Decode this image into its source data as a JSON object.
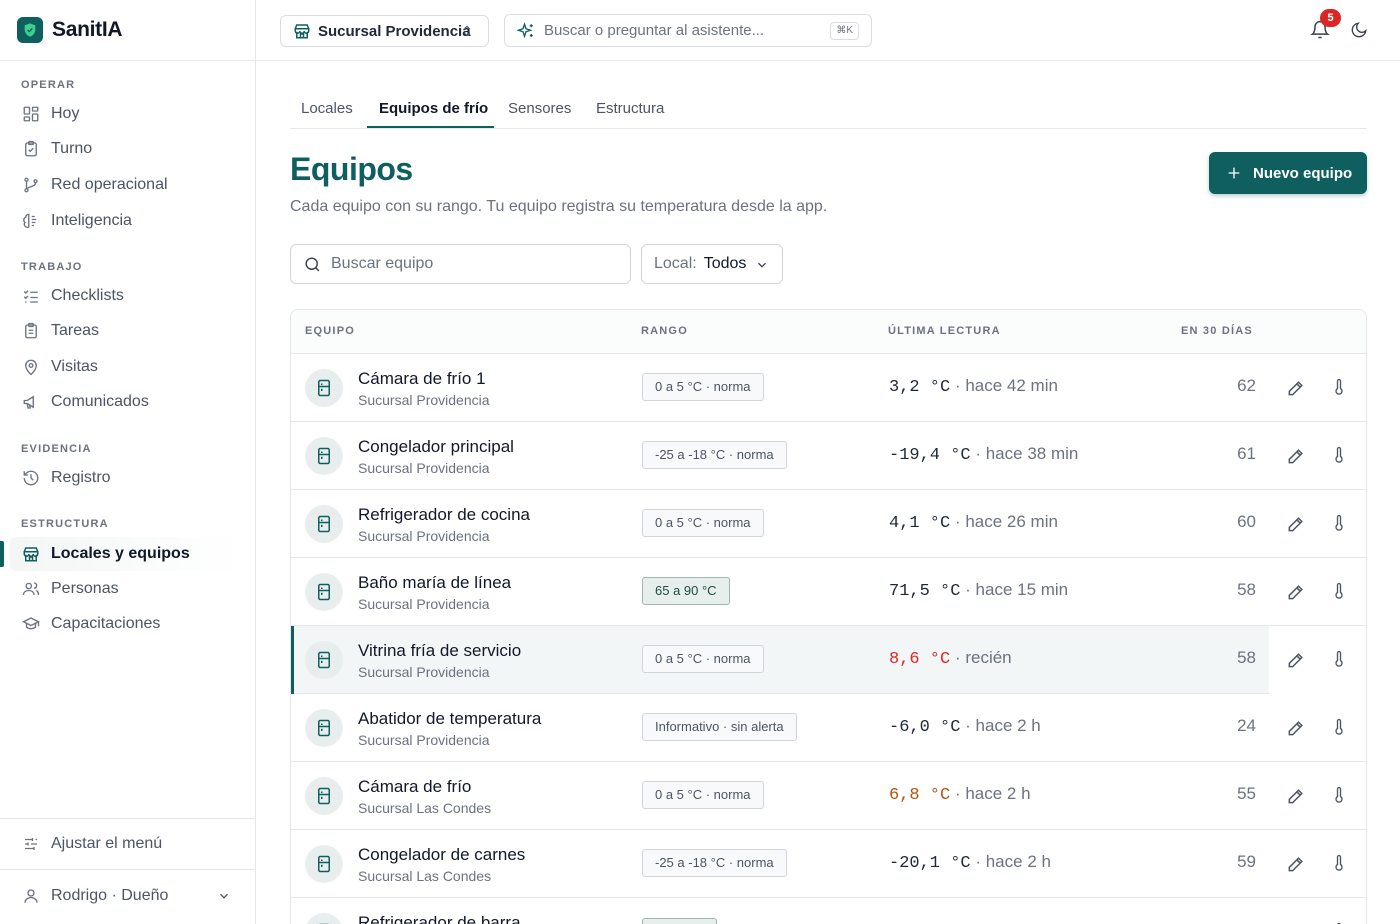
{
  "app": {
    "name": "SanitIA"
  },
  "sidebar": {
    "sections": [
      {
        "title": "OPERAR"
      },
      {
        "title": "TRABAJO"
      },
      {
        "title": "EVIDENCIA"
      },
      {
        "title": "ESTRUCTURA"
      }
    ],
    "items": [
      {
        "label": "Hoy",
        "icon": "dashboard-icon"
      },
      {
        "label": "Turno",
        "icon": "clipboard-icon"
      },
      {
        "label": "Red operacional",
        "icon": "branch-icon"
      },
      {
        "label": "Inteligencia",
        "icon": "brain-icon"
      },
      {
        "label": "Checklists",
        "icon": "checklist-icon"
      },
      {
        "label": "Tareas",
        "icon": "clipboard-icon"
      },
      {
        "label": "Visitas",
        "icon": "map-pin-icon"
      },
      {
        "label": "Comunicados",
        "icon": "megaphone-icon"
      },
      {
        "label": "Registro",
        "icon": "history-icon"
      },
      {
        "label": "Locales y equipos",
        "icon": "store-icon",
        "active": true
      },
      {
        "label": "Personas",
        "icon": "users-icon"
      },
      {
        "label": "Capacitaciones",
        "icon": "graduation-cap-icon"
      }
    ],
    "adjust_menu": "Ajustar el menú",
    "user": "Rodrigo · Dueño"
  },
  "topbar": {
    "branch": "Sucursal Providencia",
    "search_placeholder": "Buscar o preguntar al asistente...",
    "shortcut": "⌘K",
    "notifications_count": "5"
  },
  "tabs": [
    {
      "label": "Locales"
    },
    {
      "label": "Equipos de frío",
      "active": true
    },
    {
      "label": "Sensores"
    },
    {
      "label": "Estructura"
    }
  ],
  "page": {
    "title": "Equipos",
    "subtitle": "Cada equipo con su rango. Tu equipo registra su temperatura desde la app.",
    "new_button": "Nuevo equipo",
    "search_placeholder": "Buscar equipo",
    "filter_label": "Local:",
    "filter_value": "Todos"
  },
  "table": {
    "headers": {
      "equipo": "EQUIPO",
      "rango": "RANGO",
      "lectura": "ÚLTIMA LECTURA",
      "dias": "EN 30 DÍAS"
    },
    "rows": [
      {
        "name": "Cámara de frío 1",
        "location": "Sucursal Providencia",
        "range": "0 a 5 °C · norma",
        "temp": "3,2 °C",
        "when": " · hace 42 min",
        "count": "62",
        "range_style": "neutral",
        "temp_status": "normal"
      },
      {
        "name": "Congelador principal",
        "location": "Sucursal Providencia",
        "range": "-25 a -18 °C · norma",
        "temp": "-19,4 °C",
        "when": " · hace 38 min",
        "count": "61",
        "range_style": "neutral",
        "temp_status": "normal"
      },
      {
        "name": "Refrigerador de cocina",
        "location": "Sucursal Providencia",
        "range": "0 a 5 °C · norma",
        "temp": "4,1 °C",
        "when": " · hace 26 min",
        "count": "60",
        "range_style": "neutral",
        "temp_status": "normal"
      },
      {
        "name": "Baño maría de línea",
        "location": "Sucursal Providencia",
        "range": "65 a 90 °C",
        "temp": "71,5 °C",
        "when": " · hace 15 min",
        "count": "58",
        "range_style": "green",
        "temp_status": "normal"
      },
      {
        "name": "Vitrina fría de servicio",
        "location": "Sucursal Providencia",
        "range": "0 a 5 °C · norma",
        "temp": "8,6 °C",
        "when": " · recién",
        "count": "58",
        "range_style": "neutral",
        "temp_status": "alert",
        "highlighted": true
      },
      {
        "name": "Abatidor de temperatura",
        "location": "Sucursal Providencia",
        "range": "Informativo · sin alerta",
        "temp": "-6,0 °C",
        "when": " · hace 2 h",
        "count": "24",
        "range_style": "neutral",
        "temp_status": "normal"
      },
      {
        "name": "Cámara de frío",
        "location": "Sucursal Las Condes",
        "range": "0 a 5 °C · norma",
        "temp": "6,8 °C",
        "when": " · hace 2 h",
        "count": "55",
        "range_style": "neutral",
        "temp_status": "warning"
      },
      {
        "name": "Congelador de carnes",
        "location": "Sucursal Las Condes",
        "range": "-25 a -18 °C · norma",
        "temp": "-20,1 °C",
        "when": " · hace 2 h",
        "count": "59",
        "range_style": "neutral",
        "temp_status": "normal"
      },
      {
        "name": "Refrigerador de barra",
        "location": "",
        "range": "",
        "temp": "",
        "when": "",
        "count": "",
        "range_style": "neutral",
        "temp_status": "normal"
      }
    ]
  },
  "colors": {
    "brand": "#0f5f5e",
    "alert": "#dc2626",
    "warning": "#b45309",
    "badge": "#dc2626"
  }
}
